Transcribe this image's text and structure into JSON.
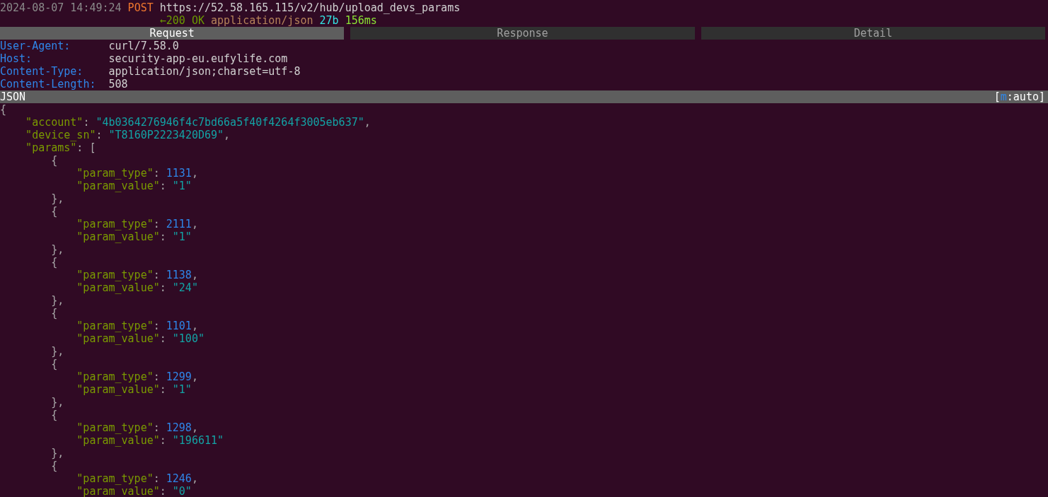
{
  "flow": {
    "timestamp": "2024-08-07 14:49:24",
    "method": "POST",
    "url": "https://52.58.165.115/v2/hub/upload_devs_params",
    "arrow": "←",
    "status": "200 OK",
    "content_type": "application/json",
    "size": "27b",
    "duration": "156ms"
  },
  "tabs": [
    {
      "label": "Request",
      "selected": true
    },
    {
      "label": "Response",
      "selected": false
    },
    {
      "label": "Detail",
      "selected": false
    }
  ],
  "headers": [
    {
      "name": "User-Agent:",
      "value": "curl/7.58.0"
    },
    {
      "name": "Host:",
      "value": "security-app-eu.eufylife.com"
    },
    {
      "name": "Content-Type:",
      "value": "application/json;charset=utf-8"
    },
    {
      "name": "Content-Length:",
      "value": "508"
    }
  ],
  "view_bar": {
    "title": "JSON",
    "mode_open": "[",
    "mode_key": "m",
    "mode_rest": ":auto]"
  },
  "body": [
    {
      "tokens": [
        {
          "kind": "punct",
          "text": "{"
        }
      ],
      "children": [
        {
          "tokens": [
            {
              "kind": "key",
              "text": "\"account\""
            },
            {
              "kind": "punct",
              "text": ": "
            },
            {
              "kind": "string",
              "text": "\"4b0364276946f4c7bd66a5f40f4264f3005eb637\""
            },
            {
              "kind": "punct",
              "text": ","
            }
          ]
        },
        {
          "tokens": [
            {
              "kind": "key",
              "text": "\"device_sn\""
            },
            {
              "kind": "punct",
              "text": ": "
            },
            {
              "kind": "string",
              "text": "\"T8160P2223420D69\""
            },
            {
              "kind": "punct",
              "text": ","
            }
          ]
        },
        {
          "tokens": [
            {
              "kind": "key",
              "text": "\"params\""
            },
            {
              "kind": "punct",
              "text": ": ["
            }
          ],
          "children": [
            {
              "tokens": [
                {
                  "kind": "punct",
                  "text": "{"
                }
              ],
              "children": [
                {
                  "tokens": [
                    {
                      "kind": "key",
                      "text": "\"param_type\""
                    },
                    {
                      "kind": "punct",
                      "text": ": "
                    },
                    {
                      "kind": "number",
                      "text": "1131"
                    },
                    {
                      "kind": "punct",
                      "text": ","
                    }
                  ]
                },
                {
                  "tokens": [
                    {
                      "kind": "key",
                      "text": "\"param_value\""
                    },
                    {
                      "kind": "punct",
                      "text": ": "
                    },
                    {
                      "kind": "string",
                      "text": "\"1\""
                    }
                  ]
                }
              ]
            },
            {
              "tokens": [
                {
                  "kind": "punct",
                  "text": "},"
                }
              ]
            },
            {
              "tokens": [
                {
                  "kind": "punct",
                  "text": "{"
                }
              ],
              "children": [
                {
                  "tokens": [
                    {
                      "kind": "key",
                      "text": "\"param_type\""
                    },
                    {
                      "kind": "punct",
                      "text": ": "
                    },
                    {
                      "kind": "number",
                      "text": "2111"
                    },
                    {
                      "kind": "punct",
                      "text": ","
                    }
                  ]
                },
                {
                  "tokens": [
                    {
                      "kind": "key",
                      "text": "\"param_value\""
                    },
                    {
                      "kind": "punct",
                      "text": ": "
                    },
                    {
                      "kind": "string",
                      "text": "\"1\""
                    }
                  ]
                }
              ]
            },
            {
              "tokens": [
                {
                  "kind": "punct",
                  "text": "},"
                }
              ]
            },
            {
              "tokens": [
                {
                  "kind": "punct",
                  "text": "{"
                }
              ],
              "children": [
                {
                  "tokens": [
                    {
                      "kind": "key",
                      "text": "\"param_type\""
                    },
                    {
                      "kind": "punct",
                      "text": ": "
                    },
                    {
                      "kind": "number",
                      "text": "1138"
                    },
                    {
                      "kind": "punct",
                      "text": ","
                    }
                  ]
                },
                {
                  "tokens": [
                    {
                      "kind": "key",
                      "text": "\"param_value\""
                    },
                    {
                      "kind": "punct",
                      "text": ": "
                    },
                    {
                      "kind": "string",
                      "text": "\"24\""
                    }
                  ]
                }
              ]
            },
            {
              "tokens": [
                {
                  "kind": "punct",
                  "text": "},"
                }
              ]
            },
            {
              "tokens": [
                {
                  "kind": "punct",
                  "text": "{"
                }
              ],
              "children": [
                {
                  "tokens": [
                    {
                      "kind": "key",
                      "text": "\"param_type\""
                    },
                    {
                      "kind": "punct",
                      "text": ": "
                    },
                    {
                      "kind": "number",
                      "text": "1101"
                    },
                    {
                      "kind": "punct",
                      "text": ","
                    }
                  ]
                },
                {
                  "tokens": [
                    {
                      "kind": "key",
                      "text": "\"param_value\""
                    },
                    {
                      "kind": "punct",
                      "text": ": "
                    },
                    {
                      "kind": "string",
                      "text": "\"100\""
                    }
                  ]
                }
              ]
            },
            {
              "tokens": [
                {
                  "kind": "punct",
                  "text": "},"
                }
              ]
            },
            {
              "tokens": [
                {
                  "kind": "punct",
                  "text": "{"
                }
              ],
              "children": [
                {
                  "tokens": [
                    {
                      "kind": "key",
                      "text": "\"param_type\""
                    },
                    {
                      "kind": "punct",
                      "text": ": "
                    },
                    {
                      "kind": "number",
                      "text": "1299"
                    },
                    {
                      "kind": "punct",
                      "text": ","
                    }
                  ]
                },
                {
                  "tokens": [
                    {
                      "kind": "key",
                      "text": "\"param_value\""
                    },
                    {
                      "kind": "punct",
                      "text": ": "
                    },
                    {
                      "kind": "string",
                      "text": "\"1\""
                    }
                  ]
                }
              ]
            },
            {
              "tokens": [
                {
                  "kind": "punct",
                  "text": "},"
                }
              ]
            },
            {
              "tokens": [
                {
                  "kind": "punct",
                  "text": "{"
                }
              ],
              "children": [
                {
                  "tokens": [
                    {
                      "kind": "key",
                      "text": "\"param_type\""
                    },
                    {
                      "kind": "punct",
                      "text": ": "
                    },
                    {
                      "kind": "number",
                      "text": "1298"
                    },
                    {
                      "kind": "punct",
                      "text": ","
                    }
                  ]
                },
                {
                  "tokens": [
                    {
                      "kind": "key",
                      "text": "\"param_value\""
                    },
                    {
                      "kind": "punct",
                      "text": ": "
                    },
                    {
                      "kind": "string",
                      "text": "\"196611\""
                    }
                  ]
                }
              ]
            },
            {
              "tokens": [
                {
                  "kind": "punct",
                  "text": "},"
                }
              ]
            },
            {
              "tokens": [
                {
                  "kind": "punct",
                  "text": "{"
                }
              ],
              "children": [
                {
                  "tokens": [
                    {
                      "kind": "key",
                      "text": "\"param_type\""
                    },
                    {
                      "kind": "punct",
                      "text": ": "
                    },
                    {
                      "kind": "number",
                      "text": "1246"
                    },
                    {
                      "kind": "punct",
                      "text": ","
                    }
                  ]
                },
                {
                  "tokens": [
                    {
                      "kind": "key",
                      "text": "\"param_value\""
                    },
                    {
                      "kind": "punct",
                      "text": ": "
                    },
                    {
                      "kind": "string",
                      "text": "\"0\""
                    }
                  ]
                }
              ]
            }
          ]
        }
      ]
    }
  ]
}
